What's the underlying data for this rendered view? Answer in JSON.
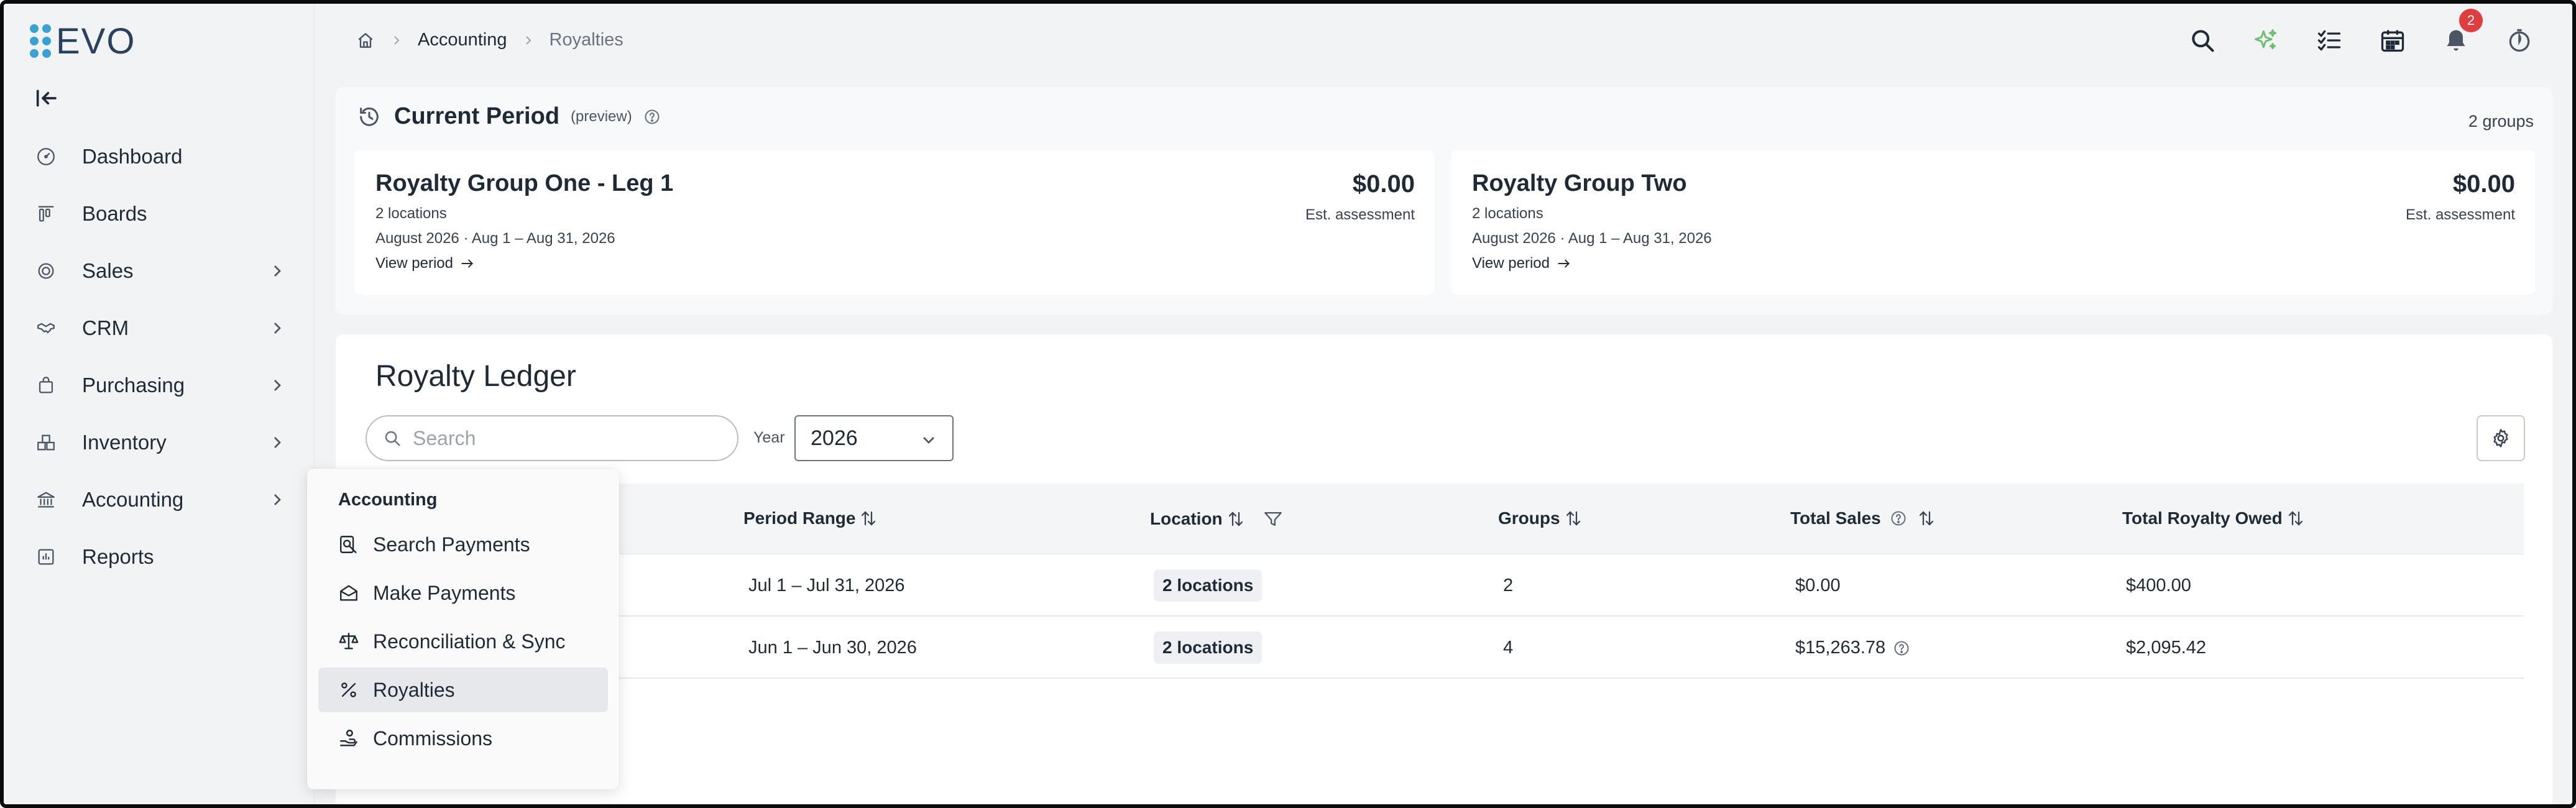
{
  "brand": {
    "logo_text": "EVO",
    "accent": "#3aa0d8"
  },
  "sidebar": {
    "items": [
      {
        "label": "Dashboard",
        "icon": "gauge-icon",
        "has_children": false
      },
      {
        "label": "Boards",
        "icon": "kanban-icon",
        "has_children": false
      },
      {
        "label": "Sales",
        "icon": "coin-icon",
        "has_children": true
      },
      {
        "label": "CRM",
        "icon": "handshake-icon",
        "has_children": true
      },
      {
        "label": "Purchasing",
        "icon": "shopping-bag-icon",
        "has_children": true
      },
      {
        "label": "Inventory",
        "icon": "boxes-icon",
        "has_children": true
      },
      {
        "label": "Accounting",
        "icon": "bank-icon",
        "has_children": true
      },
      {
        "label": "Reports",
        "icon": "chart-icon",
        "has_children": false
      }
    ]
  },
  "breadcrumb": {
    "section": "Accounting",
    "current": "Royalties"
  },
  "topbar": {
    "notification_count": "2"
  },
  "current_period": {
    "title": "Current Period",
    "subtitle": "(preview)",
    "count": "2 groups",
    "groups": [
      {
        "name": "Royalty Group One - Leg 1",
        "locations": "2 locations",
        "range": "August 2026  ·  Aug 1 – Aug 31, 2026",
        "view_label": "View period",
        "amount": "$0.00",
        "amount_label": "Est. assessment"
      },
      {
        "name": "Royalty Group Two",
        "locations": "2 locations",
        "range": "August 2026  ·  Aug 1 – Aug 31, 2026",
        "view_label": "View period",
        "amount": "$0.00",
        "amount_label": "Est. assessment"
      }
    ]
  },
  "ledger": {
    "title": "Royalty Ledger",
    "search_placeholder": "Search",
    "year_label": "Year",
    "year_value": "2026",
    "columns": {
      "period_range": "Period Range",
      "location": "Location",
      "groups": "Groups",
      "total_sales": "Total Sales",
      "total_royalty": "Total Royalty Owed"
    },
    "rows": [
      {
        "period_range": "Jul 1 – Jul 31, 2026",
        "location": "2 locations",
        "groups": "2",
        "total_sales": "$0.00",
        "total_royalty": "$400.00"
      },
      {
        "period_range": "Jun 1 – Jun 30, 2026",
        "location": "2 locations",
        "groups": "4",
        "total_sales": "$15,263.78",
        "total_royalty": "$2,095.42"
      }
    ]
  },
  "accounting_menu": {
    "title": "Accounting",
    "items": [
      {
        "label": "Search Payments",
        "icon": "search-doc-icon"
      },
      {
        "label": "Make Payments",
        "icon": "envelope-open-icon"
      },
      {
        "label": "Reconciliation & Sync",
        "icon": "scale-icon"
      },
      {
        "label": "Royalties",
        "icon": "percent-icon",
        "active": true
      },
      {
        "label": "Commissions",
        "icon": "hand-coin-icon"
      }
    ]
  }
}
